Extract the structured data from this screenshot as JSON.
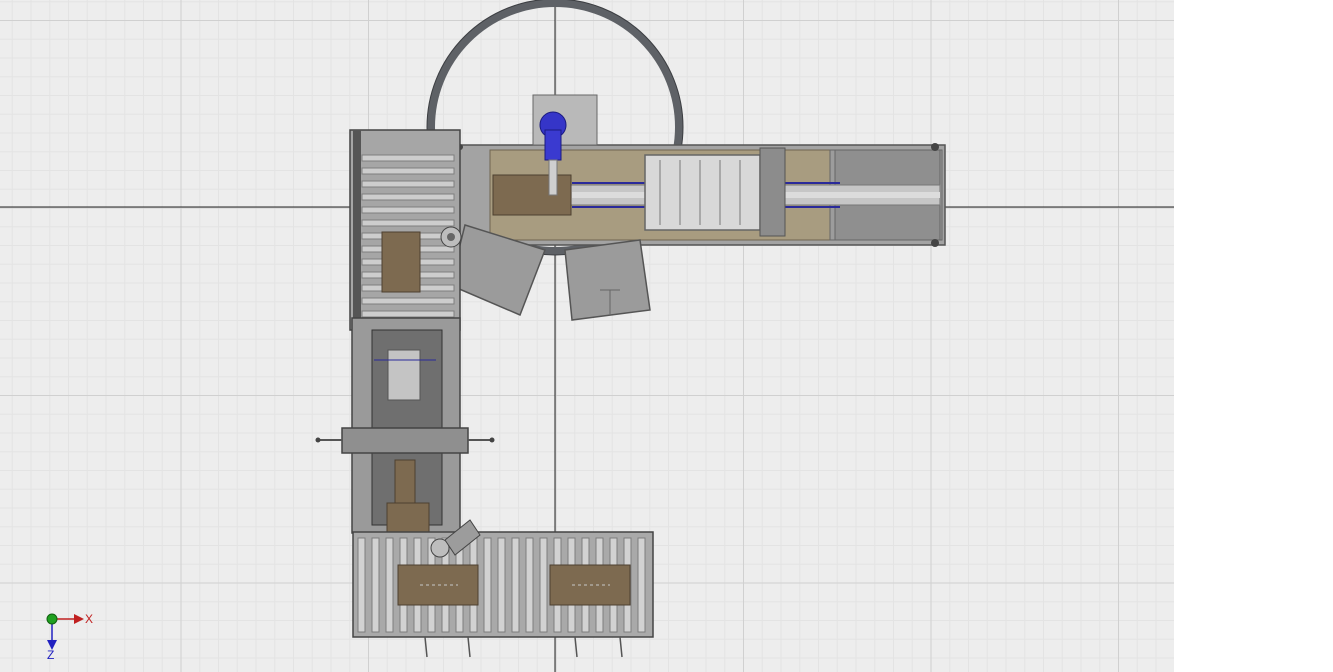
{
  "viewport": {
    "background_color": "#ededed",
    "grid_color": "#d0d0d0",
    "crosshair_color": "#222222"
  },
  "axis_gizmo": {
    "x_label": "X",
    "z_label": "Z",
    "x_color": "#c02020",
    "z_color": "#2020c0",
    "origin_color": "#20a020"
  },
  "scene": {
    "view": "top",
    "materials": {
      "steel": "#8a8a8a",
      "steel_dark": "#555555",
      "roller": "#b8b8b8",
      "wood_box": "#7d6a50",
      "panel_beige": "#a89c80",
      "motor_blue": "#3535c8",
      "carton_grey": "#9b9b9b"
    },
    "components": [
      "robot-reach-ring",
      "infeed-roller-conveyor",
      "belt-conveyor",
      "palletizer-station",
      "outfeed-roller-conveyor",
      "servo-motor",
      "carton-stack"
    ]
  }
}
